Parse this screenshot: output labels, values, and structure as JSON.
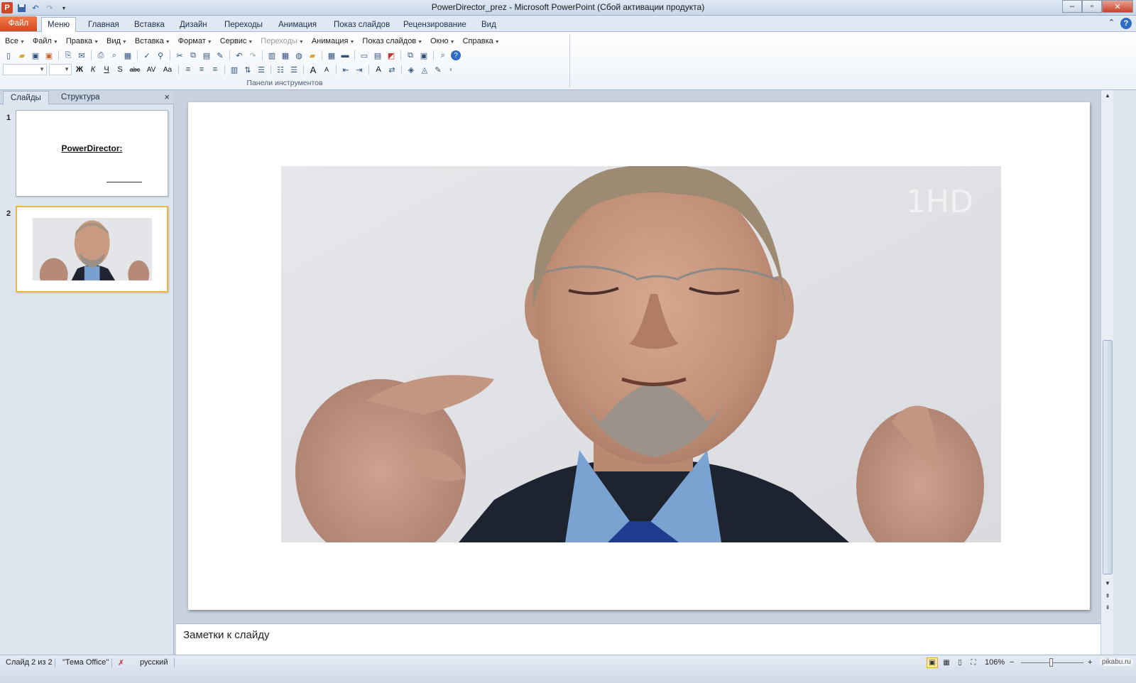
{
  "window": {
    "title": "PowerDirector_prez  -  Microsoft PowerPoint (Сбой активации продукта)",
    "minimize": "–",
    "maximize": "▫",
    "close": "✕"
  },
  "ribbon_tabs": [
    "Файл",
    "Меню",
    "Главная",
    "Вставка",
    "Дизайн",
    "Переходы",
    "Анимация",
    "Показ слайдов",
    "Рецензирование",
    "Вид"
  ],
  "active_tab": "Меню",
  "menu_items": [
    {
      "label": "Все",
      "disabled": false
    },
    {
      "label": "Файл",
      "disabled": false
    },
    {
      "label": "Правка",
      "disabled": false
    },
    {
      "label": "Вид",
      "disabled": false
    },
    {
      "label": "Вставка",
      "disabled": false
    },
    {
      "label": "Формат",
      "disabled": false
    },
    {
      "label": "Сервис",
      "disabled": false
    },
    {
      "label": "Переходы",
      "disabled": true
    },
    {
      "label": "Анимация",
      "disabled": false
    },
    {
      "label": "Показ слайдов",
      "disabled": false
    },
    {
      "label": "Окно",
      "disabled": false
    },
    {
      "label": "Справка",
      "disabled": false
    }
  ],
  "toolbar": {
    "bold": "Ж",
    "italic": "К",
    "underline": "Ч",
    "shadow": "S",
    "strike": "abc",
    "spacing": "AV",
    "case": "Aa",
    "grow": "A",
    "shrink": "A",
    "group_label": "Панели инструментов"
  },
  "left_pane": {
    "tabs": [
      "Слайды",
      "Структура"
    ],
    "close": "×",
    "slides": [
      {
        "number": "1",
        "title": "PowerDirector:"
      },
      {
        "number": "2"
      }
    ]
  },
  "notes": {
    "placeholder": "Заметки к слайду"
  },
  "status": {
    "slide_info": "Слайд 2 из 2",
    "theme": "\"Тема Office\"",
    "language": "русский",
    "zoom": "106%",
    "zoom_minus": "−",
    "zoom_plus": "+",
    "watermark": "pikabu.ru"
  }
}
